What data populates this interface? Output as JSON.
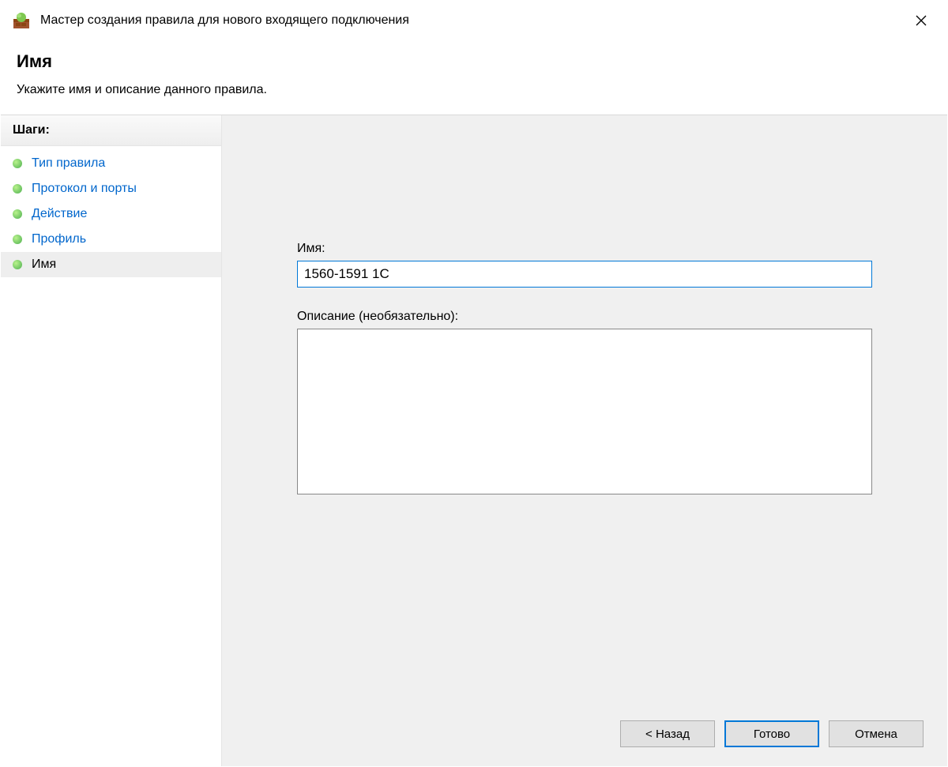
{
  "window": {
    "title": "Мастер создания правила для нового входящего подключения"
  },
  "header": {
    "title": "Имя",
    "subtitle": "Укажите имя и описание данного правила."
  },
  "sidebar": {
    "header": "Шаги:",
    "items": [
      {
        "label": "Тип правила",
        "active": false
      },
      {
        "label": "Протокол и порты",
        "active": false
      },
      {
        "label": "Действие",
        "active": false
      },
      {
        "label": "Профиль",
        "active": false
      },
      {
        "label": "Имя",
        "active": true
      }
    ]
  },
  "form": {
    "name_label": "Имя:",
    "name_value": "1560-1591 1C",
    "description_label": "Описание (необязательно):",
    "description_value": ""
  },
  "buttons": {
    "back": "< Назад",
    "finish": "Готово",
    "cancel": "Отмена"
  }
}
